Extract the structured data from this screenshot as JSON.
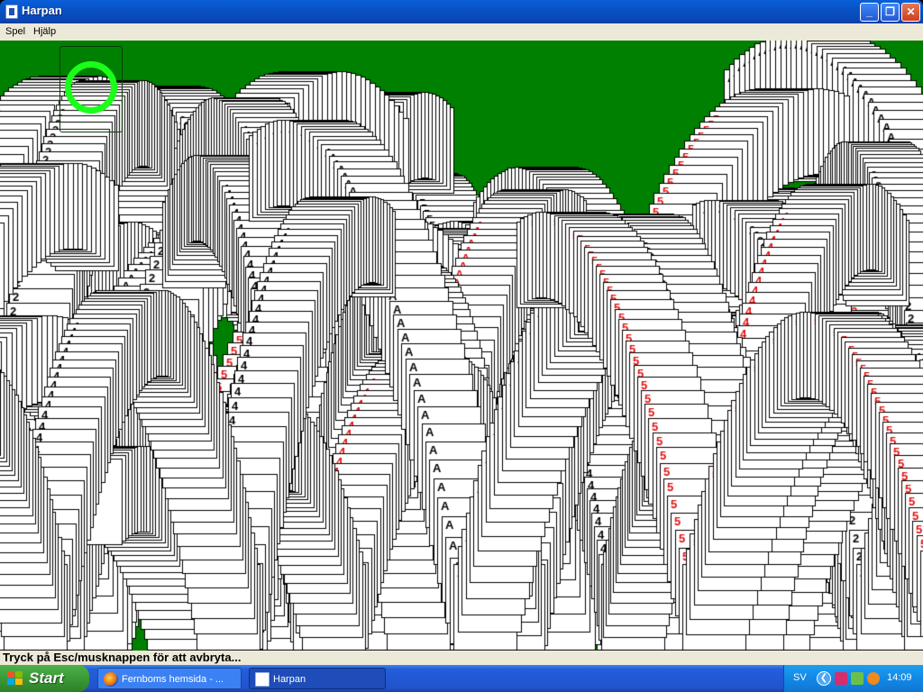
{
  "window": {
    "title": "Harpan",
    "minimize_glyph": "_",
    "maximize_glyph": "❐",
    "close_glyph": "✕"
  },
  "menu": {
    "items": [
      "Spel",
      "Hjälp"
    ]
  },
  "game": {
    "background_color": "#008000",
    "stock_indicator_color": "#19ff19",
    "card_ranks_visible": [
      "2",
      "5",
      "A",
      "4"
    ]
  },
  "status": {
    "text": "Tryck på Esc/musknappen för att avbryta..."
  },
  "taskbar": {
    "start_label": "Start",
    "tasks": [
      {
        "label": "Fernboms hemsida - ...",
        "icon": "firefox-icon",
        "active": false
      },
      {
        "label": "Harpan",
        "icon": "spider-solitaire-icon",
        "active": true
      }
    ],
    "tray": {
      "language": "SV",
      "expand_glyph": "❮",
      "clock": "14:09"
    }
  }
}
